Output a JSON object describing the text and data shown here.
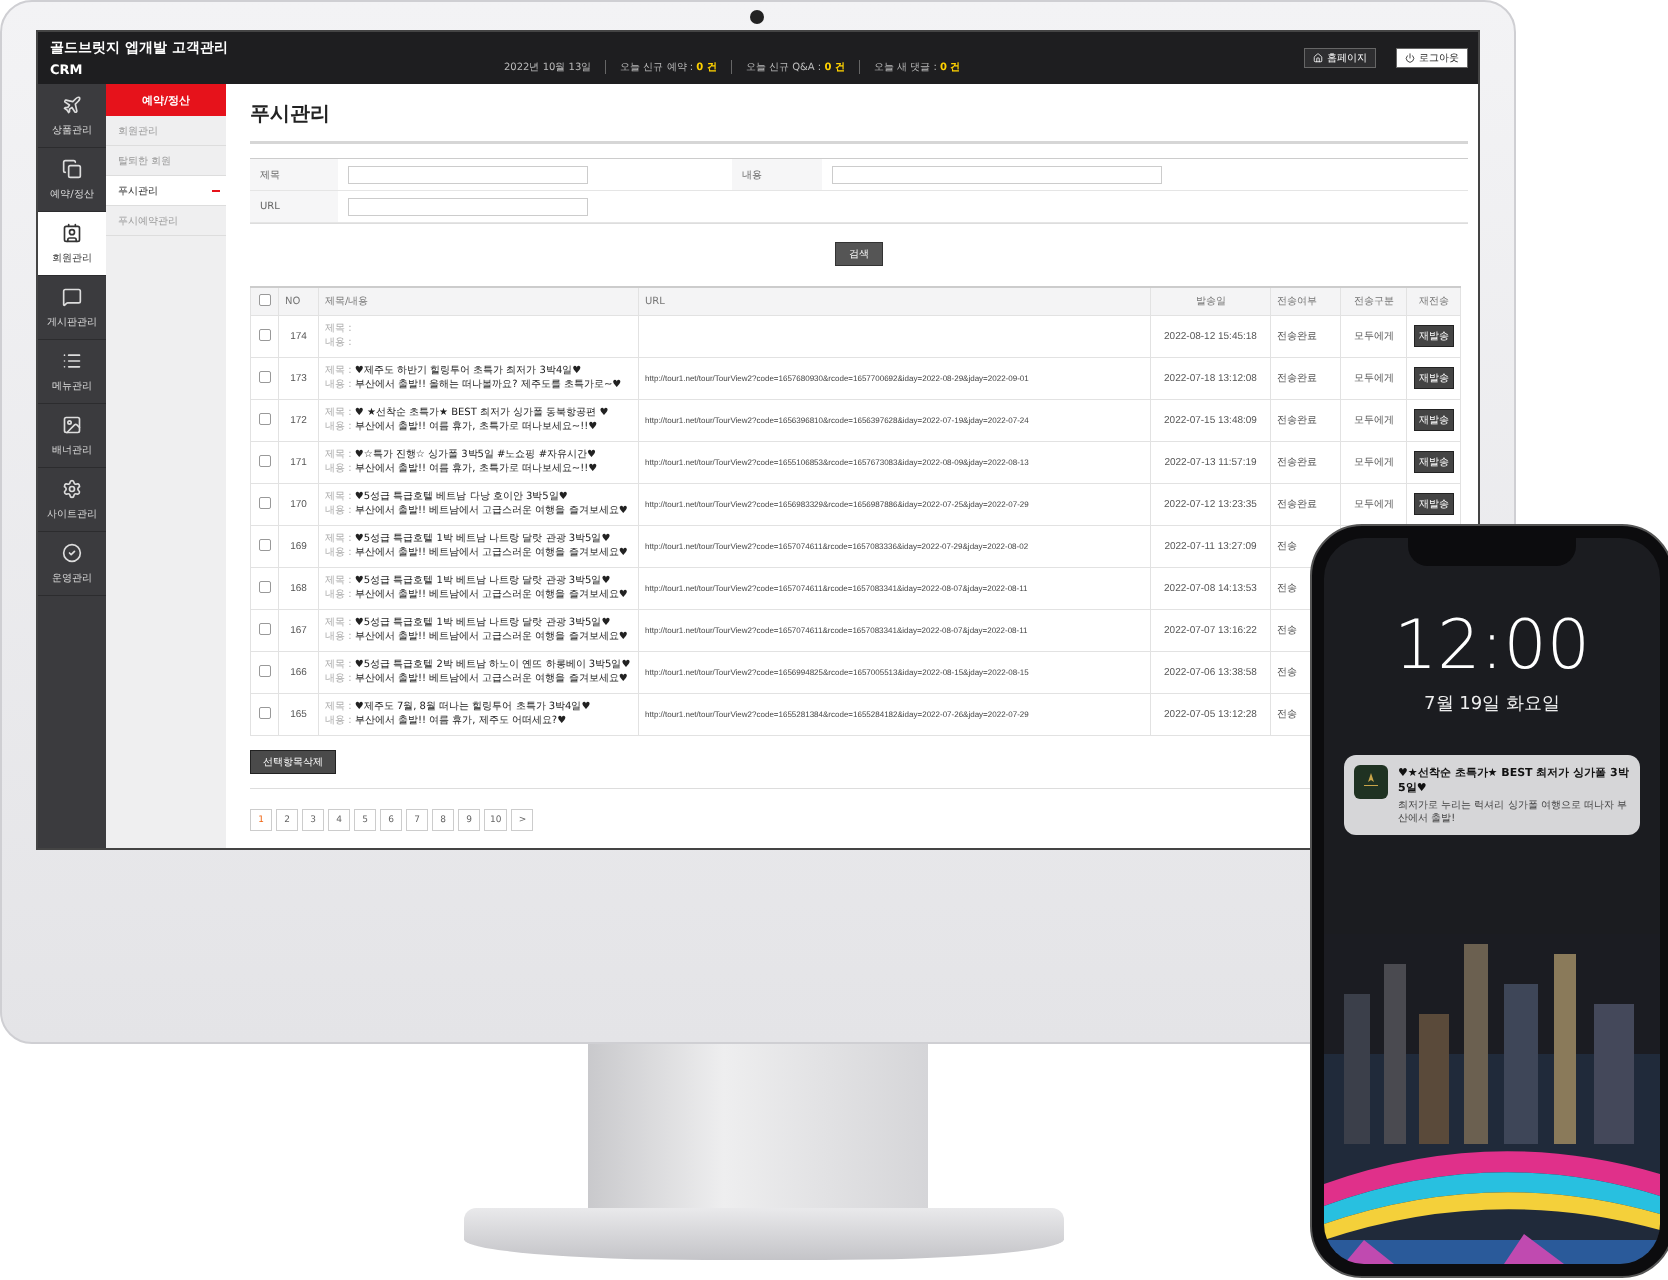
{
  "header": {
    "title": "골드브릿지 엡개발 고객관리",
    "subtitle": "CRM",
    "date": "2022년 10월 13일",
    "stats": [
      {
        "label": "오늘 신규 예약 :",
        "count": "0 건"
      },
      {
        "label": "오늘 신규 Q&A :",
        "count": "0 건"
      },
      {
        "label": "오늘 새 댓글 :",
        "count": "0 건"
      }
    ],
    "buttons": [
      {
        "label": "홈페이지",
        "kind": "home"
      },
      {
        "label": "로그아웃",
        "kind": "logout"
      }
    ]
  },
  "sidebar": {
    "items": [
      {
        "label": "상품관리",
        "selected": false
      },
      {
        "label": "예약/정산",
        "selected": false
      },
      {
        "label": "회원관리",
        "selected": true
      },
      {
        "label": "게시판관리",
        "selected": false
      },
      {
        "label": "메뉴관리",
        "selected": false
      },
      {
        "label": "배너관리",
        "selected": false
      },
      {
        "label": "사이트관리",
        "selected": false
      },
      {
        "label": "운영관리",
        "selected": false
      }
    ]
  },
  "submenu": {
    "title": "예약/정산",
    "items": [
      {
        "label": "회원관리",
        "selected": false
      },
      {
        "label": "탈퇴한 회원",
        "selected": false
      },
      {
        "label": "푸시관리",
        "selected": true
      },
      {
        "label": "푸시예약관리",
        "selected": false
      }
    ]
  },
  "page_title": "푸시관리",
  "search": {
    "fields": [
      {
        "label": "제목"
      },
      {
        "label": "내용"
      },
      {
        "label": "URL"
      }
    ],
    "button": "검색"
  },
  "table": {
    "select_all_checked": false,
    "columns": [
      "NO",
      "제목/내용",
      "URL",
      "발송일",
      "전송여부",
      "전송구분",
      "재전송"
    ],
    "rows": [
      {
        "checked": false,
        "no": "174",
        "title_label": "제목 :",
        "content_label": "내용 :",
        "sent_at": "2022-08-12 15:45:18",
        "status": "전송완료",
        "target": "모두에게",
        "resend": "재발송"
      },
      {
        "checked": false,
        "no": "173",
        "title_label": "제목 :",
        "title": "♥제주도 하반기 힐링투어 초특가 최저가 3박4일♥",
        "content_label": "내용 :",
        "content": "부산에서 출발!! 올해는 떠나볼까요? 제주도를 초특가로~♥",
        "url": "http://tour1.net/tour/TourView2?code=1657680930&rcode=1657700692&iday=2022-08-29&jday=2022-09-01",
        "sent_at": "2022-07-18 13:12:08",
        "status": "전송완료",
        "target": "모두에게",
        "resend": "재발송"
      },
      {
        "checked": false,
        "no": "172",
        "title_label": "제목 :",
        "title": "♥ ★선착순 초특가★ BEST 최저가 싱가폴 동북항공편 ♥",
        "content_label": "내용 :",
        "content": "부산에서 출발!! 여름 휴가, 초특가로 떠나보세요~!!♥",
        "url": "http://tour1.net/tour/TourView2?code=1656396810&rcode=1656397628&iday=2022-07-19&jday=2022-07-24",
        "sent_at": "2022-07-15 13:48:09",
        "status": "전송완료",
        "target": "모두에게",
        "resend": "재발송"
      },
      {
        "checked": false,
        "no": "171",
        "title_label": "제목 :",
        "title": "♥☆특가 진행☆ 싱가폴 3박5일 #노쇼핑 #자유시간♥",
        "content_label": "내용 :",
        "content": "부산에서 출발!! 여름 휴가, 초특가로 떠나보세요~!!♥",
        "url": "http://tour1.net/tour/TourView2?code=1655106853&rcode=1657673083&iday=2022-08-09&jday=2022-08-13",
        "sent_at": "2022-07-13 11:57:19",
        "status": "전송완료",
        "target": "모두에게",
        "resend": "재발송"
      },
      {
        "checked": false,
        "no": "170",
        "title_label": "제목 :",
        "title": "♥5성급 특급호텔 베트남 다낭 호이안 3박5일♥",
        "content_label": "내용 :",
        "content": "부산에서 출발!! 베트남에서 고급스러운 여행을 즐겨보세요♥",
        "url": "http://tour1.net/tour/TourView2?code=1656983329&rcode=1656987886&iday=2022-07-25&jday=2022-07-29",
        "sent_at": "2022-07-12 13:23:35",
        "status": "전송완료",
        "target": "모두에게",
        "resend": "재발송"
      },
      {
        "checked": false,
        "no": "169",
        "title_label": "제목 :",
        "title": "♥5성급 특급호텔 1박 베트남 나트랑 달랏 관광 3박5일♥",
        "content_label": "내용 :",
        "content": "부산에서 출발!! 베트남에서 고급스러운 여행을 즐겨보세요♥",
        "url": "http://tour1.net/tour/TourView2?code=1657074611&rcode=1657083336&iday=2022-07-29&jday=2022-08-02",
        "sent_at": "2022-07-11 13:27:09",
        "status": "전송"
      },
      {
        "checked": false,
        "no": "168",
        "title_label": "제목 :",
        "title": "♥5성급 특급호텔 1박 베트남 나트랑 달랏 관광 3박5일♥",
        "content_label": "내용 :",
        "content": "부산에서 출발!! 베트남에서 고급스러운 여행을 즐겨보세요♥",
        "url": "http://tour1.net/tour/TourView2?code=1657074611&rcode=1657083341&iday=2022-08-07&jday=2022-08-11",
        "sent_at": "2022-07-08 14:13:53",
        "status": "전송"
      },
      {
        "checked": false,
        "no": "167",
        "title_label": "제목 :",
        "title": "♥5성급 특급호텔 1박 베트남 나트랑 달랏 관광 3박5일♥",
        "content_label": "내용 :",
        "content": "부산에서 출발!! 베트남에서 고급스러운 여행을 즐겨보세요♥",
        "url": "http://tour1.net/tour/TourView2?code=1657074611&rcode=1657083341&iday=2022-08-07&jday=2022-08-11",
        "sent_at": "2022-07-07 13:16:22",
        "status": "전송"
      },
      {
        "checked": false,
        "no": "166",
        "title_label": "제목 :",
        "title": "♥5성급 특급호텔 2박 베트남 하노이 옌뜨 하롱베이 3박5일♥",
        "content_label": "내용 :",
        "content": "부산에서 출발!! 베트남에서 고급스러운 여행을 즐겨보세요♥",
        "url": "http://tour1.net/tour/TourView2?code=1656994825&rcode=1657005513&iday=2022-08-15&jday=2022-08-15",
        "sent_at": "2022-07-06 13:38:58",
        "status": "전송"
      },
      {
        "checked": false,
        "no": "165",
        "title_label": "제목 :",
        "title": "♥제주도 7월, 8월 떠나는 힐링투어 초특가 3박4일♥",
        "content_label": "내용 :",
        "content": "부산에서 출발!! 여름 휴가, 제주도 어떠세요?♥",
        "url": "http://tour1.net/tour/TourView2?code=1655281384&rcode=1655284182&iday=2022-07-26&jday=2022-07-29",
        "sent_at": "2022-07-05 13:12:28",
        "status": "전송"
      }
    ]
  },
  "delete_button": "선택항목삭제",
  "pagination": {
    "pages": [
      {
        "label": "1",
        "selected": true
      },
      {
        "label": "2",
        "selected": false
      },
      {
        "label": "3",
        "selected": false
      },
      {
        "label": "4",
        "selected": false
      },
      {
        "label": "5",
        "selected": false
      },
      {
        "label": "6",
        "selected": false
      },
      {
        "label": "7",
        "selected": false
      },
      {
        "label": "8",
        "selected": false
      },
      {
        "label": "9",
        "selected": false
      },
      {
        "label": "10",
        "selected": false
      }
    ],
    "next": ">"
  },
  "phone": {
    "time": "12:00",
    "date": "7월 19일 화요일",
    "notification": {
      "title": "♥★선착순 초특가★ BEST 최저가 싱가폴 3박 5일♥",
      "body": "최저가로 누리는 럭셔리 싱가폴 여행으로 떠나자 부산에서 출발!"
    }
  }
}
